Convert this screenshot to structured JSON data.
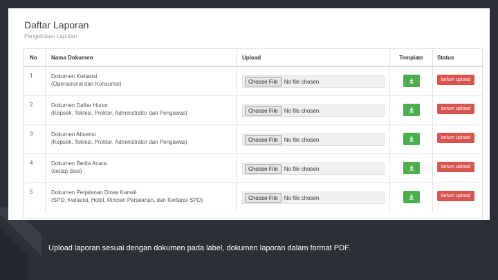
{
  "panel": {
    "title": "Daftar Laporan",
    "subtitle": "Pengelolaan Laporan"
  },
  "table": {
    "headers": {
      "no": "No",
      "doc": "Nama Dokumen",
      "upload": "Upload",
      "template": "Template",
      "status": "Status"
    },
    "file_button_label": "Choose File",
    "file_placeholder": "No file chosen",
    "rows": [
      {
        "no": "1",
        "name": "Dokumen Kwitansi",
        "detail": "(Operasional dan Konsumsi)",
        "status": "belum upload"
      },
      {
        "no": "2",
        "name": "Dokumen Daftar Honor",
        "detail": "(Kepsek, Teknisi, Proktor, Administrator dan Pengawas)",
        "status": "belum upload"
      },
      {
        "no": "3",
        "name": "Dokumen Absensi",
        "detail": "(Kepsek, Teknisi, Proktor, Administrator dan Pengawas)",
        "status": "belum upload"
      },
      {
        "no": "4",
        "name": "Dokumen Berita Acara",
        "detail": "(setiap Sesi)",
        "status": "belum upload"
      },
      {
        "no": "5",
        "name": "Dokumen Perjalanan Dinas Kanwil",
        "detail": "(SPD, Kwitansi, Hotel, Rincian Perjalanan, dan Kwitansi SPD)",
        "status": "belum upload"
      }
    ]
  },
  "caption": "Upload laporan sesuai dengan dokumen pada label, dokumen laporan dalam format PDF.",
  "colors": {
    "template_button": "#4cae4c",
    "status_badge": "#d9534f",
    "background": "#2b2f36"
  },
  "icons": {
    "template": "download-icon"
  }
}
